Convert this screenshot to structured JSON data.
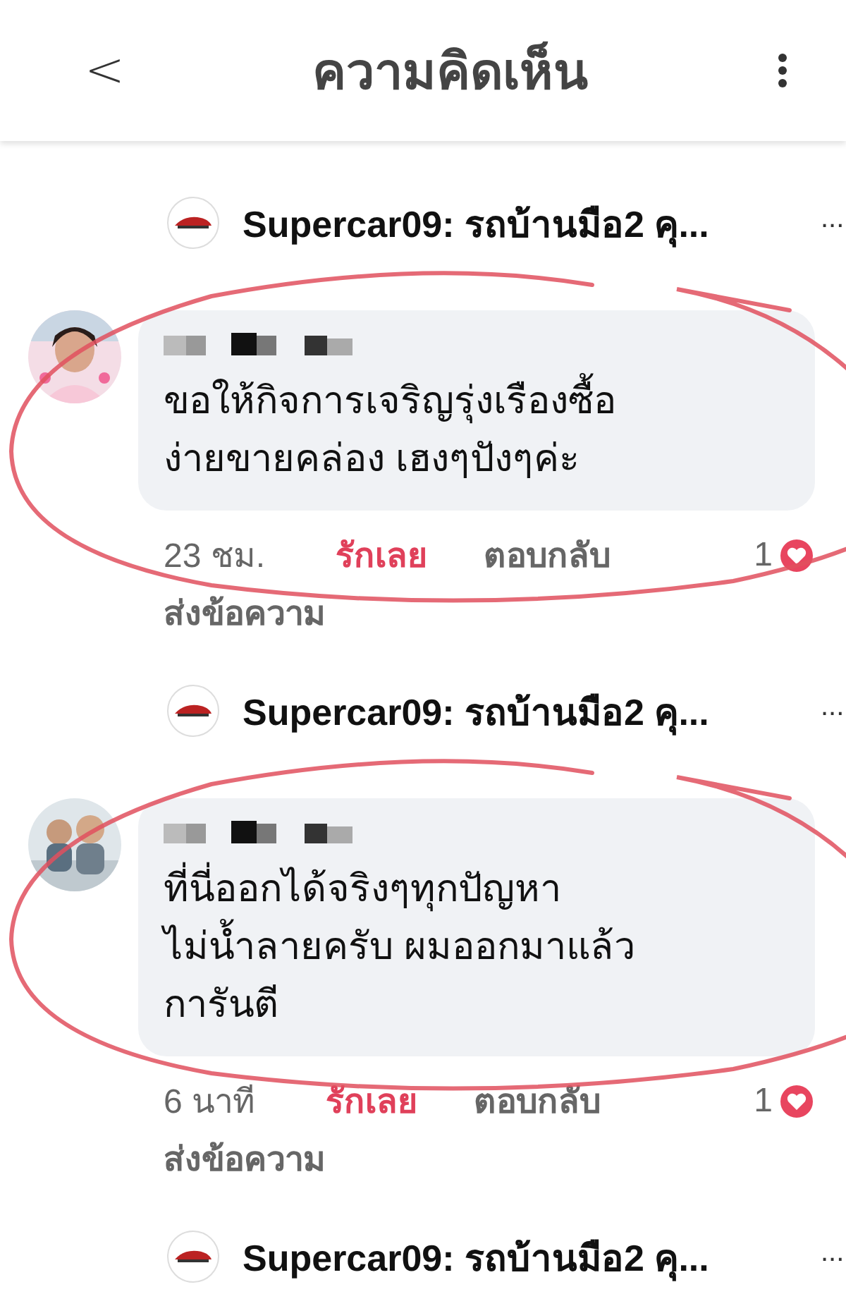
{
  "header": {
    "back": "<",
    "title": "ความคิดเห็น"
  },
  "items": [
    {
      "kind": "reply",
      "link": "Supercar09: รถบ้านมือ2 คุ...",
      "more": "..."
    },
    {
      "kind": "comment",
      "lines": [
        "ขอให้กิจการเจริญรุ่งเรืองซื้อ",
        "ง่ายขายคล่อง เฮงๆปังๆค่ะ"
      ],
      "time": "23 ชม.",
      "love": "รักเลย",
      "loved": true,
      "reply": "ตอบกลับ",
      "count": "1",
      "message": "ส่งข้อความ",
      "circled": true
    },
    {
      "kind": "reply",
      "link": "Supercar09: รถบ้านมือ2 คุ...",
      "more": "..."
    },
    {
      "kind": "comment",
      "lines": [
        "ที่นี่ออกได้จริงๆทุกปัญหา",
        "ไม่น้ำลายครับ ผมออกมาแล้ว",
        "การันตี"
      ],
      "time": "6 นาที",
      "love": "รักเลย",
      "loved": true,
      "reply": "ตอบกลับ",
      "count": "1",
      "message": "ส่งข้อความ",
      "circled": true
    },
    {
      "kind": "reply",
      "link": "Supercar09: รถบ้านมือ2 คุ...",
      "more": "..."
    }
  ]
}
